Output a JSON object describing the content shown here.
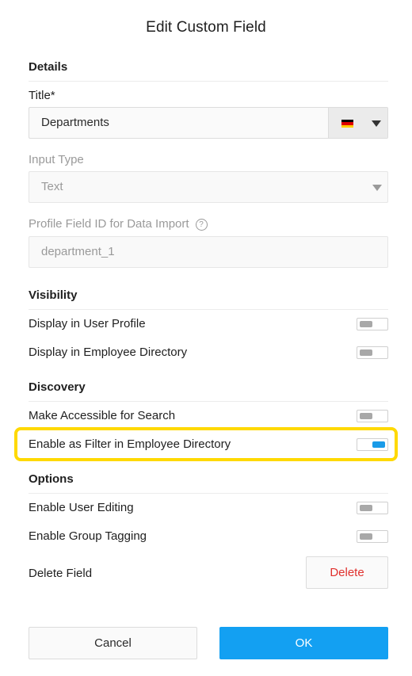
{
  "dialog": {
    "title": "Edit Custom Field"
  },
  "details": {
    "heading": "Details",
    "title_label": "Title*",
    "title_value": "Departments",
    "input_type_label": "Input Type",
    "input_type_value": "Text",
    "profile_id_label": "Profile Field ID for Data Import",
    "profile_id_help": "?",
    "profile_id_value": "department_1"
  },
  "visibility": {
    "heading": "Visibility",
    "rows": [
      {
        "label": "Display in User Profile",
        "enabled": false
      },
      {
        "label": "Display in Employee Directory",
        "enabled": false
      }
    ]
  },
  "discovery": {
    "heading": "Discovery",
    "rows": [
      {
        "label": "Make Accessible for Search",
        "enabled": false
      },
      {
        "label": "Enable as Filter in Employee Directory",
        "enabled": true
      }
    ]
  },
  "options": {
    "heading": "Options",
    "rows": [
      {
        "label": "Enable User Editing",
        "enabled": false
      },
      {
        "label": "Enable Group Tagging",
        "enabled": false
      }
    ],
    "delete_label": "Delete Field",
    "delete_button": "Delete"
  },
  "footer": {
    "cancel": "Cancel",
    "ok": "OK"
  },
  "colors": {
    "accent": "#13a0f2",
    "toggle_on": "#1a9be8",
    "danger": "#e0302d",
    "highlight": "#ffd900",
    "flag": [
      "#000000",
      "#dd0000",
      "#ffce00"
    ]
  },
  "icons": {
    "language_flag": "german-flag-icon",
    "dropdown": "caret-down-icon",
    "help": "question-circle-icon"
  }
}
